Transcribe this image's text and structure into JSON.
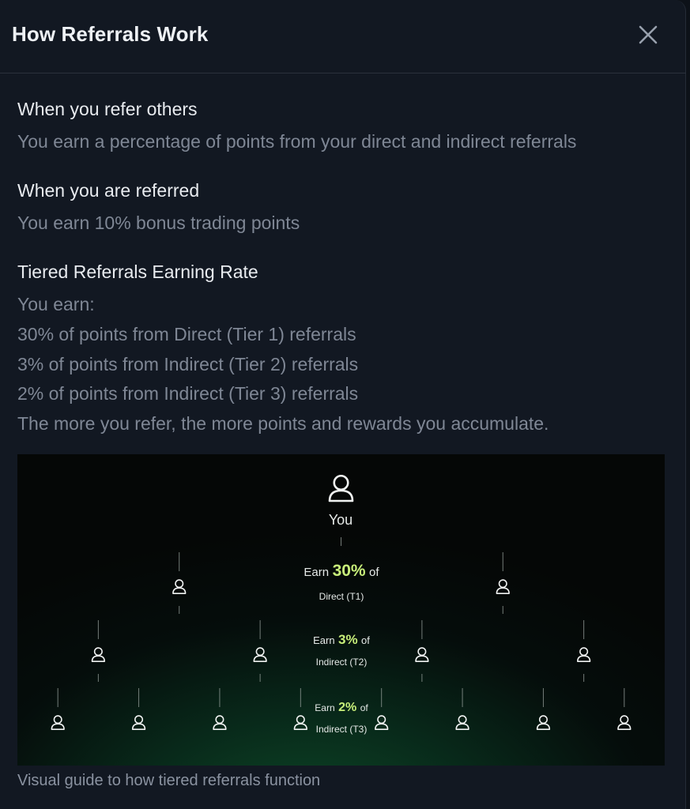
{
  "header": {
    "title": "How Referrals Work",
    "close_icon": "close-icon"
  },
  "sections": [
    {
      "title": "When you refer others",
      "lines": [
        "You earn a percentage of points from your direct and indirect referrals"
      ]
    },
    {
      "title": "When you are referred",
      "lines": [
        "You earn 10% bonus trading points"
      ]
    },
    {
      "title": "Tiered Referrals Earning Rate",
      "lines": [
        "You earn:",
        "30% of points from Direct (Tier 1) referrals",
        "3% of points from Indirect (Tier 2) referrals",
        "2% of points from Indirect (Tier 3) referrals",
        "The more you refer, the more points and rewards you accumulate."
      ]
    }
  ],
  "diagram": {
    "root_label": "You",
    "user_icon": "user-icon",
    "accent_color": "#c8ef7a",
    "tiers": [
      {
        "earn": "Earn",
        "percent": "30%",
        "of": "of",
        "name": "Direct (T1)",
        "count": 2
      },
      {
        "earn": "Earn",
        "percent": "3%",
        "of": "of",
        "name": "Indirect (T2)",
        "count": 4
      },
      {
        "earn": "Earn",
        "percent": "2%",
        "of": "of",
        "name": "Indirect (T3)",
        "count": 8
      }
    ]
  },
  "caption": "Visual guide to how tiered referrals function"
}
